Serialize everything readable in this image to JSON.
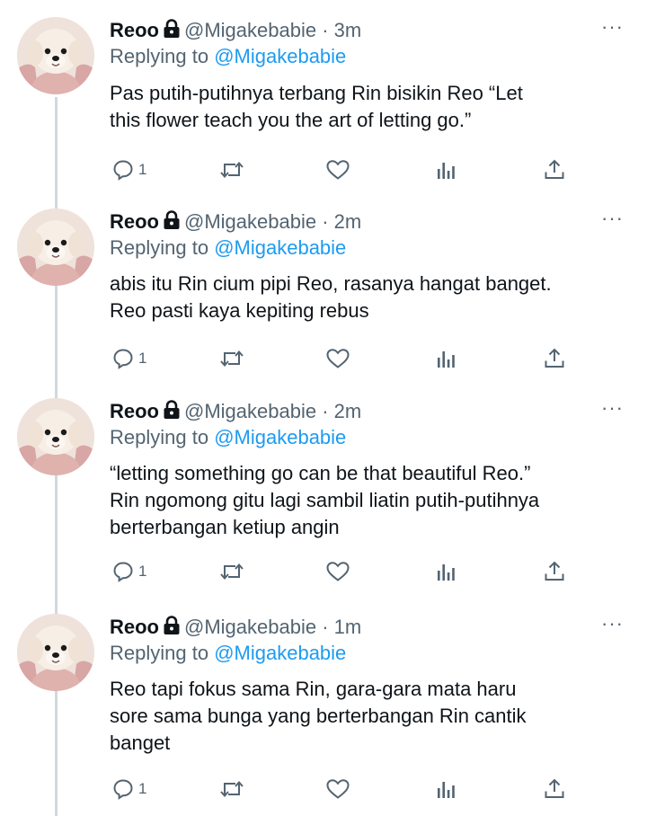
{
  "author": {
    "name": "Reoo",
    "handle": "@Migakebabie",
    "separator": "·"
  },
  "reply_prefix": "Replying to",
  "reply_mention": "@Migakebabie",
  "more_label": "···",
  "colors": {
    "text": "#0f1419",
    "secondary": "#536471",
    "accent": "#1d9bf0",
    "thread_line": "#cfd9de"
  },
  "tweets": [
    {
      "time": "3m",
      "text": "Pas putih-putihnya terbang Rin bisikin Reo “Let\nthis flower teach you the art of letting go.”",
      "reply_count": "1"
    },
    {
      "time": "2m",
      "text": "abis itu Rin cium pipi Reo, rasanya hangat banget.\nReo pasti kaya kepiting rebus",
      "reply_count": "1"
    },
    {
      "time": "2m",
      "text": "“letting something go can be that beautiful Reo.”\nRin ngomong gitu lagi sambil liatin putih-putihnya\nberterbangan ketiup angin",
      "reply_count": "1"
    },
    {
      "time": "1m",
      "text": "Reo tapi fokus sama Rin, gara-gara mata haru\nsore sama bunga yang berterbangan Rin cantik\nbanget",
      "reply_count": "1"
    }
  ],
  "icons": [
    "lock-icon",
    "reply-icon",
    "retweet-icon",
    "like-icon",
    "analytics-icon",
    "share-icon",
    "more-icon"
  ]
}
